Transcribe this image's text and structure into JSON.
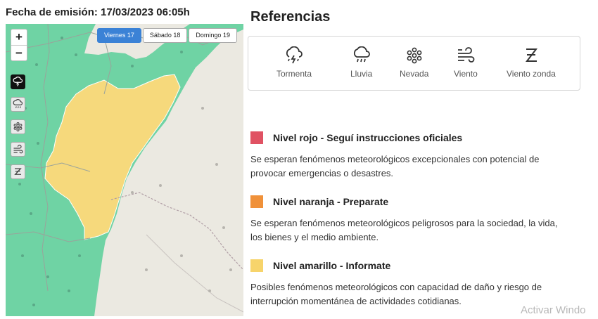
{
  "issue_date": "Fecha de emisión: 17/03/2023 06:05h",
  "map": {
    "zoom_in": "+",
    "zoom_out": "−",
    "days": [
      {
        "label": "Viernes 17",
        "active": true
      },
      {
        "label": "Sábado 18",
        "active": false
      },
      {
        "label": "Domingo 19",
        "active": false
      }
    ],
    "layers": [
      {
        "icon": "storm-icon",
        "active": true
      },
      {
        "icon": "rain-icon",
        "active": false
      },
      {
        "icon": "snow-icon",
        "active": false
      },
      {
        "icon": "wind-icon",
        "active": false
      },
      {
        "icon": "zonda-wind-icon",
        "active": false
      }
    ],
    "colors": {
      "green": "#6fd3a4",
      "yellow": "#f6d97c",
      "land": "#ebe9e1"
    }
  },
  "references": {
    "title": "Referencias",
    "items": [
      {
        "icon": "storm-icon",
        "label": "Tormenta"
      },
      {
        "icon": "rain-icon",
        "label": "Lluvia"
      },
      {
        "icon": "snow-icon",
        "label": "Nevada"
      },
      {
        "icon": "wind-icon",
        "label": "Viento"
      },
      {
        "icon": "zonda-wind-icon",
        "label": "Viento zonda"
      }
    ]
  },
  "levels": [
    {
      "color": "#e05263",
      "title": "Nivel rojo - Seguí instrucciones oficiales",
      "description": "Se esperan fenómenos meteorológicos excepcionales con potencial de provocar emergencias o desastres."
    },
    {
      "color": "#f0913a",
      "title": "Nivel naranja - Preparate",
      "description": "Se esperan fenómenos meteorológicos peligrosos para la sociedad, la vida, los bienes y el medio ambiente."
    },
    {
      "color": "#f7d46b",
      "title": "Nivel amarillo - Informate",
      "description": "Posibles fenómenos meteorológicos con capacidad de daño y riesgo de interrupción momentánea de actividades cotidianas."
    }
  ],
  "watermark": "Activar Windo"
}
